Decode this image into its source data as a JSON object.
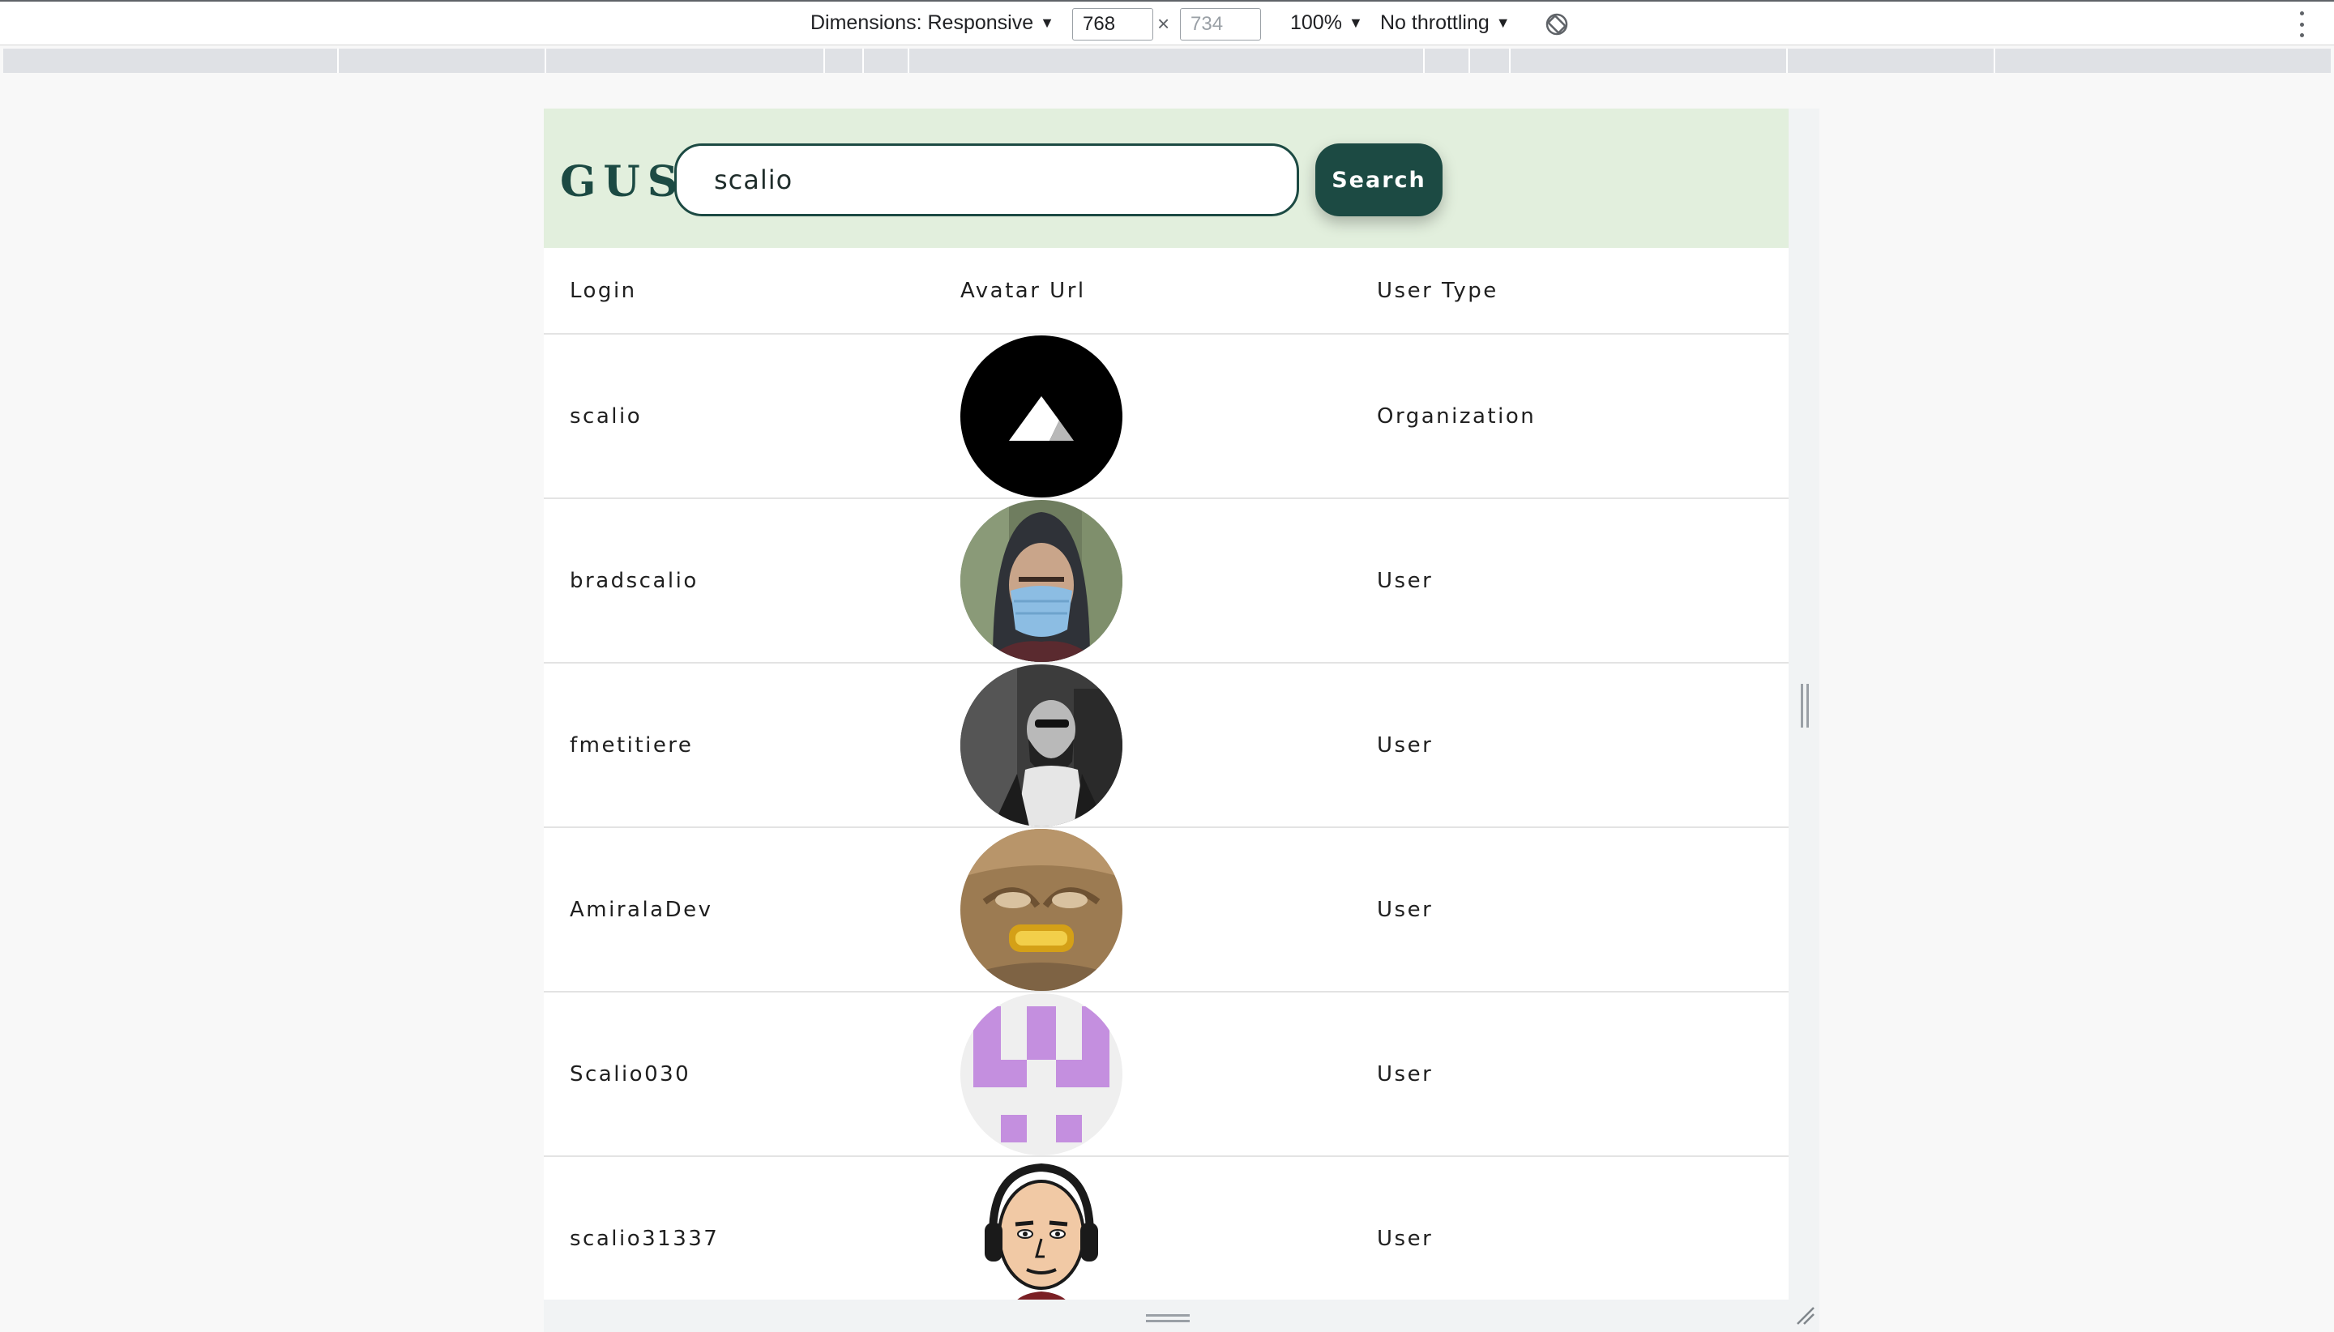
{
  "devtools": {
    "dimensions_label": "Dimensions: Responsive",
    "width_value": "768",
    "height_value": "734",
    "times_symbol": "×",
    "zoom_label": "100%",
    "throttling_label": "No throttling",
    "rotate_icon": "rotate-icon",
    "more_icon": "kebab-icon"
  },
  "app": {
    "logo": "GUS",
    "search": {
      "value": "scalio"
    },
    "search_button_label": "Search",
    "colors": {
      "header_bg": "#e2efdd",
      "primary": "#1c4a43"
    }
  },
  "table": {
    "headers": [
      "Login",
      "Avatar Url",
      "User Type"
    ],
    "rows": [
      {
        "login": "scalio",
        "avatar": "scalio-logo-avatar",
        "type": "Organization"
      },
      {
        "login": "bradscalio",
        "avatar": "masked-person-avatar",
        "type": "User"
      },
      {
        "login": "fmetitiere",
        "avatar": "bw-bearded-man-avatar",
        "type": "User"
      },
      {
        "login": "AmiralaDev",
        "avatar": "golden-face-avatar",
        "type": "User"
      },
      {
        "login": "Scalio030",
        "avatar": "identicon-avatar",
        "type": "User"
      },
      {
        "login": "scalio31337",
        "avatar": "cartoon-man-headphones-avatar",
        "type": "User"
      }
    ]
  }
}
